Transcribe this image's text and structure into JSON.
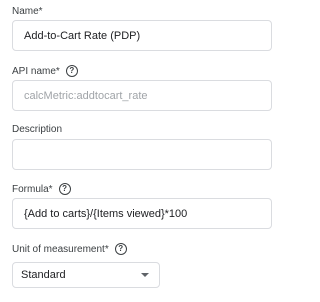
{
  "name": {
    "label": "Name*",
    "value": "Add-to-Cart Rate (PDP)"
  },
  "api_name": {
    "label": "API name*",
    "help_icon": "help-circle-icon",
    "value": "calcMetric:addtocart_rate"
  },
  "description": {
    "label": "Description",
    "value": ""
  },
  "formula": {
    "label": "Formula*",
    "help_icon": "help-circle-icon",
    "value": "{Add to carts}/{Items viewed}*100"
  },
  "unit": {
    "label": "Unit of measurement*",
    "help_icon": "help-circle-icon",
    "selected": "Standard"
  }
}
